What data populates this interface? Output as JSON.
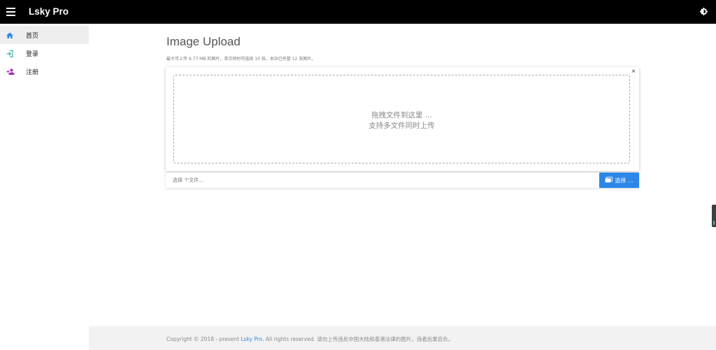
{
  "topbar": {
    "brand": "Lsky Pro",
    "menu_icon": "menu-icon",
    "theme_icon": "brightness-icon"
  },
  "sidebar": {
    "items": [
      {
        "label": "首页",
        "icon": "home-icon",
        "icon_color": "#2d87e8",
        "active": true
      },
      {
        "label": "登录",
        "icon": "login-icon",
        "icon_color": "#17a2a0",
        "active": false
      },
      {
        "label": "注册",
        "icon": "user-plus-icon",
        "icon_color": "#9c27b0",
        "active": false
      }
    ]
  },
  "main": {
    "title": "Image Upload",
    "subtitle": "最大可上传 9.77 MB 的图片，单次同时可选择 10 张。本站已托管 12 张图片。"
  },
  "upload": {
    "close_label": "×",
    "drop_line1": "拖拽文件到这里 ...",
    "drop_line2": "支持多文件同时上传",
    "file_placeholder": "选择 个文件...",
    "choose_label": "选择 ..."
  },
  "footer": {
    "prefix": "Copyright © 2018 - present ",
    "link": "Lsky Pro",
    "suffix": ". All rights reserved. 请勿上传违反中国大陆和香港法律的图片，违者后果自负。"
  },
  "colors": {
    "accent": "#2d87e8",
    "topbar_bg": "#000000",
    "footer_bg": "#f2f2f2"
  }
}
